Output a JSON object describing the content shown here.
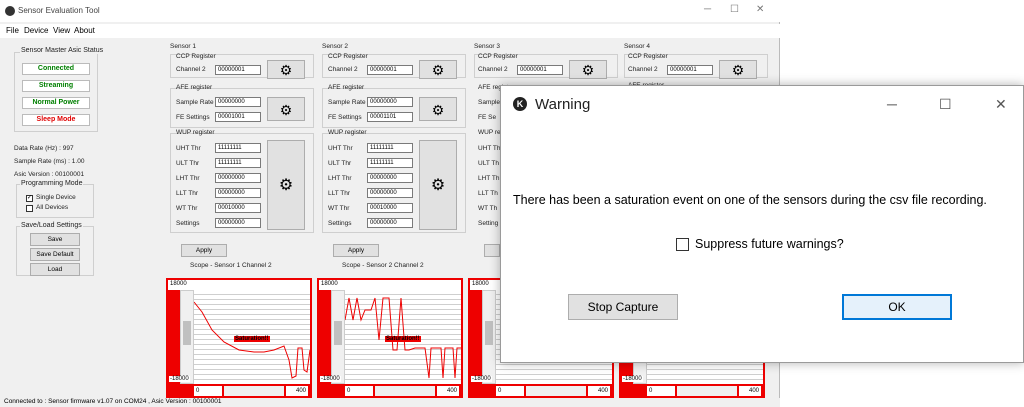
{
  "app": {
    "title": "Sensor Evaluation Tool"
  },
  "menu": [
    "File",
    "Device",
    "View",
    "About"
  ],
  "left": {
    "group_title": "Sensor Master Asic Status",
    "status": [
      {
        "label": "Connected",
        "color": "#008000"
      },
      {
        "label": "Streaming",
        "color": "#008000"
      },
      {
        "label": "Normal Power",
        "color": "#008000"
      },
      {
        "label": "Sleep Mode",
        "color": "#e00000"
      }
    ],
    "data_rate": "Data Rate (Hz) : 997",
    "sample_rate": "Sample Rate (ms) : 1.00",
    "asic_version": "Asic Version : 00100001",
    "prog_title": "Programming Mode",
    "single_device": "Single Device",
    "all_devices": "All Devices",
    "saveload_title": "Save/Load Settings",
    "save": "Save",
    "save_default": "Save Default",
    "load": "Load"
  },
  "sensors": [
    {
      "title": "Sensor 1",
      "ch2": "00000001",
      "sample_rate": "00000000",
      "fe": "00001001",
      "uht": "11111111",
      "ult": "11111111",
      "lht": "00000000",
      "llt": "00000000",
      "wt": "00010000",
      "settings": "00000000",
      "scope_title": "Scope - Sensor 1 Channel 2"
    },
    {
      "title": "Sensor 2",
      "ch2": "00000001",
      "sample_rate": "00000000",
      "fe": "00001101",
      "uht": "11111111",
      "ult": "11111111",
      "lht": "00000000",
      "llt": "00000000",
      "wt": "00010000",
      "settings": "00000000",
      "scope_title": "Scope - Sensor 2 Channel 2"
    },
    {
      "title": "Sensor 3",
      "ch2": "00000001"
    },
    {
      "title": "Sensor 4",
      "ch2": "00000001"
    }
  ],
  "labels": {
    "ccp": "CCP Register",
    "channel2": "Channel 2",
    "afe": "AFE register",
    "sample_rate": "Sample Rate",
    "fe": "FE Settings",
    "wup": "WUP register",
    "uht": "UHT Thr",
    "ult": "ULT Thr",
    "lht": "LHT Thr",
    "llt": "LLT Thr",
    "wt": "WT Thr",
    "settings": "Settings",
    "apply": "Apply",
    "afe_short": "AFE register",
    "sample_short": "Sample",
    "fe_short": "FE Se",
    "wup_short": "WUP re",
    "uht_short": "UHT Th",
    "ult_short": "ULT Th",
    "lht_short": "LHT Th",
    "llt_short": "LLT Th",
    "wt_short": "WT Th",
    "setting_short": "Setting"
  },
  "scope": {
    "ymax": "18000",
    "ymin": "-18000",
    "x0": "0",
    "x1": "400",
    "saturation": "Saturation!!"
  },
  "status_bar": "Connected to : Sensor firmware v1.07 on COM24 , Asic Version : 00100001",
  "dialog": {
    "title": "Warning",
    "message": "There has been a saturation event on one of the sensors during the csv file recording.",
    "checkbox": "Suppress future warnings?",
    "stop": "Stop Capture",
    "ok": "OK"
  }
}
